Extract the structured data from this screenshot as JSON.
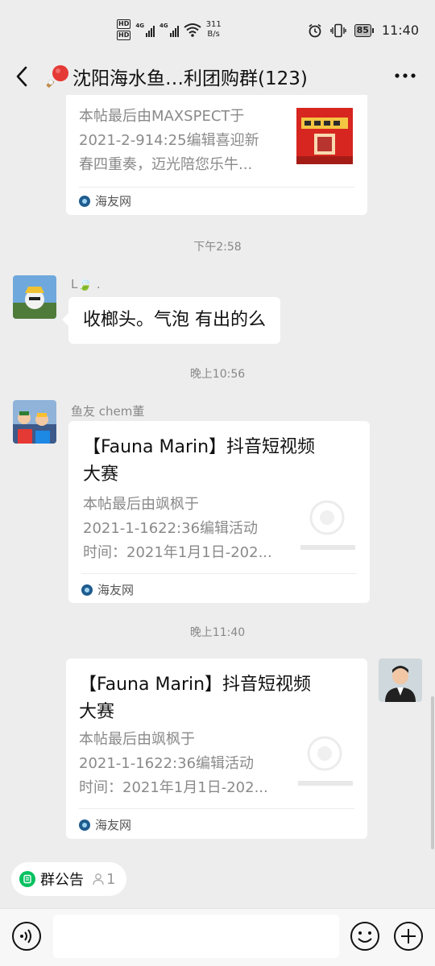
{
  "status_bar": {
    "hd1": "HD",
    "hd2": "HD",
    "net1": "4G",
    "net2": "4G",
    "speed_value": "311",
    "speed_unit": "B/s",
    "battery": "85",
    "time": "11:40"
  },
  "nav": {
    "title": "沈阳海水鱼…利团购群(123)"
  },
  "messages": [
    {
      "type": "link-card",
      "desc_lines": [
        "本帖最后由MAXSPECT于",
        "2021-2-914:25编辑喜迎新",
        "春四重奏，迈光陪您乐牛..."
      ],
      "source": "海友网"
    },
    {
      "type": "time",
      "text": "下午2:58"
    },
    {
      "type": "text",
      "sender": "L🍃 .",
      "text": "收榔头。气泡 有出的么"
    },
    {
      "type": "time",
      "text": "晚上10:56"
    },
    {
      "type": "link-card",
      "sender": "鱼友 chem董",
      "title_lines": [
        "【Fauna Marin】抖音短视频",
        "大赛"
      ],
      "desc_lines": [
        "本帖最后由飒枫于",
        "2021-1-1622:36编辑活动",
        "时间：2021年1月1日-202..."
      ],
      "source": "海友网"
    },
    {
      "type": "time",
      "text": "晚上11:40"
    },
    {
      "type": "link-card",
      "title_lines": [
        "【Fauna Marin】抖音短视频",
        "大赛"
      ],
      "desc_lines": [
        "本帖最后由飒枫于",
        "2021-1-1622:36编辑活动",
        "时间：2021年1月1日-202..."
      ],
      "source": "海友网"
    }
  ],
  "announcement": {
    "label": "群公告",
    "count": "1"
  },
  "input": {
    "placeholder": ""
  },
  "colors": {
    "background": "#ededed",
    "bubble": "#ffffff",
    "accent_green": "#07c160"
  },
  "icons": [
    "back-chevron-icon",
    "ping-pong-icon",
    "more-dots-icon",
    "voice-icon",
    "emoji-icon",
    "plus-icon",
    "alarm-icon",
    "vibrate-icon",
    "wifi-icon",
    "battery-icon",
    "person-icon",
    "announcement-icon"
  ]
}
